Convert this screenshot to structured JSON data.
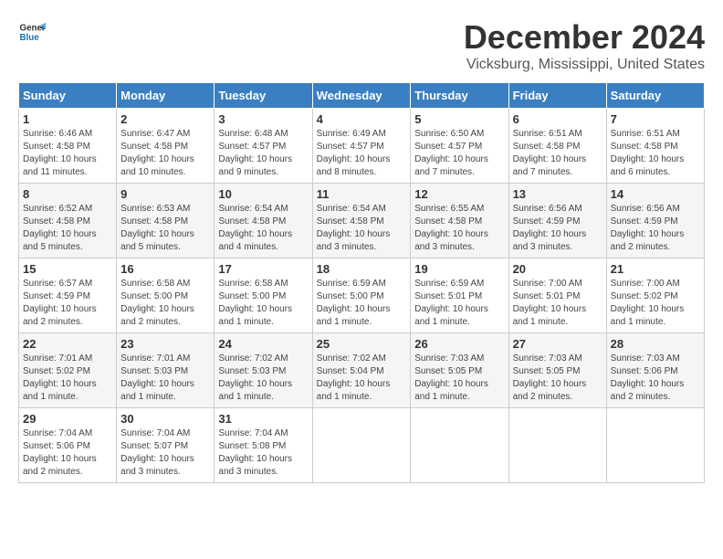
{
  "logo": {
    "general": "General",
    "blue": "Blue"
  },
  "title": "December 2024",
  "subtitle": "Vicksburg, Mississippi, United States",
  "days_of_week": [
    "Sunday",
    "Monday",
    "Tuesday",
    "Wednesday",
    "Thursday",
    "Friday",
    "Saturday"
  ],
  "weeks": [
    [
      {
        "day": "1",
        "sunrise": "Sunrise: 6:46 AM",
        "sunset": "Sunset: 4:58 PM",
        "daylight": "Daylight: 10 hours and 11 minutes."
      },
      {
        "day": "2",
        "sunrise": "Sunrise: 6:47 AM",
        "sunset": "Sunset: 4:58 PM",
        "daylight": "Daylight: 10 hours and 10 minutes."
      },
      {
        "day": "3",
        "sunrise": "Sunrise: 6:48 AM",
        "sunset": "Sunset: 4:57 PM",
        "daylight": "Daylight: 10 hours and 9 minutes."
      },
      {
        "day": "4",
        "sunrise": "Sunrise: 6:49 AM",
        "sunset": "Sunset: 4:57 PM",
        "daylight": "Daylight: 10 hours and 8 minutes."
      },
      {
        "day": "5",
        "sunrise": "Sunrise: 6:50 AM",
        "sunset": "Sunset: 4:57 PM",
        "daylight": "Daylight: 10 hours and 7 minutes."
      },
      {
        "day": "6",
        "sunrise": "Sunrise: 6:51 AM",
        "sunset": "Sunset: 4:58 PM",
        "daylight": "Daylight: 10 hours and 7 minutes."
      },
      {
        "day": "7",
        "sunrise": "Sunrise: 6:51 AM",
        "sunset": "Sunset: 4:58 PM",
        "daylight": "Daylight: 10 hours and 6 minutes."
      }
    ],
    [
      {
        "day": "8",
        "sunrise": "Sunrise: 6:52 AM",
        "sunset": "Sunset: 4:58 PM",
        "daylight": "Daylight: 10 hours and 5 minutes."
      },
      {
        "day": "9",
        "sunrise": "Sunrise: 6:53 AM",
        "sunset": "Sunset: 4:58 PM",
        "daylight": "Daylight: 10 hours and 5 minutes."
      },
      {
        "day": "10",
        "sunrise": "Sunrise: 6:54 AM",
        "sunset": "Sunset: 4:58 PM",
        "daylight": "Daylight: 10 hours and 4 minutes."
      },
      {
        "day": "11",
        "sunrise": "Sunrise: 6:54 AM",
        "sunset": "Sunset: 4:58 PM",
        "daylight": "Daylight: 10 hours and 3 minutes."
      },
      {
        "day": "12",
        "sunrise": "Sunrise: 6:55 AM",
        "sunset": "Sunset: 4:58 PM",
        "daylight": "Daylight: 10 hours and 3 minutes."
      },
      {
        "day": "13",
        "sunrise": "Sunrise: 6:56 AM",
        "sunset": "Sunset: 4:59 PM",
        "daylight": "Daylight: 10 hours and 3 minutes."
      },
      {
        "day": "14",
        "sunrise": "Sunrise: 6:56 AM",
        "sunset": "Sunset: 4:59 PM",
        "daylight": "Daylight: 10 hours and 2 minutes."
      }
    ],
    [
      {
        "day": "15",
        "sunrise": "Sunrise: 6:57 AM",
        "sunset": "Sunset: 4:59 PM",
        "daylight": "Daylight: 10 hours and 2 minutes."
      },
      {
        "day": "16",
        "sunrise": "Sunrise: 6:58 AM",
        "sunset": "Sunset: 5:00 PM",
        "daylight": "Daylight: 10 hours and 2 minutes."
      },
      {
        "day": "17",
        "sunrise": "Sunrise: 6:58 AM",
        "sunset": "Sunset: 5:00 PM",
        "daylight": "Daylight: 10 hours and 1 minute."
      },
      {
        "day": "18",
        "sunrise": "Sunrise: 6:59 AM",
        "sunset": "Sunset: 5:00 PM",
        "daylight": "Daylight: 10 hours and 1 minute."
      },
      {
        "day": "19",
        "sunrise": "Sunrise: 6:59 AM",
        "sunset": "Sunset: 5:01 PM",
        "daylight": "Daylight: 10 hours and 1 minute."
      },
      {
        "day": "20",
        "sunrise": "Sunrise: 7:00 AM",
        "sunset": "Sunset: 5:01 PM",
        "daylight": "Daylight: 10 hours and 1 minute."
      },
      {
        "day": "21",
        "sunrise": "Sunrise: 7:00 AM",
        "sunset": "Sunset: 5:02 PM",
        "daylight": "Daylight: 10 hours and 1 minute."
      }
    ],
    [
      {
        "day": "22",
        "sunrise": "Sunrise: 7:01 AM",
        "sunset": "Sunset: 5:02 PM",
        "daylight": "Daylight: 10 hours and 1 minute."
      },
      {
        "day": "23",
        "sunrise": "Sunrise: 7:01 AM",
        "sunset": "Sunset: 5:03 PM",
        "daylight": "Daylight: 10 hours and 1 minute."
      },
      {
        "day": "24",
        "sunrise": "Sunrise: 7:02 AM",
        "sunset": "Sunset: 5:03 PM",
        "daylight": "Daylight: 10 hours and 1 minute."
      },
      {
        "day": "25",
        "sunrise": "Sunrise: 7:02 AM",
        "sunset": "Sunset: 5:04 PM",
        "daylight": "Daylight: 10 hours and 1 minute."
      },
      {
        "day": "26",
        "sunrise": "Sunrise: 7:03 AM",
        "sunset": "Sunset: 5:05 PM",
        "daylight": "Daylight: 10 hours and 1 minute."
      },
      {
        "day": "27",
        "sunrise": "Sunrise: 7:03 AM",
        "sunset": "Sunset: 5:05 PM",
        "daylight": "Daylight: 10 hours and 2 minutes."
      },
      {
        "day": "28",
        "sunrise": "Sunrise: 7:03 AM",
        "sunset": "Sunset: 5:06 PM",
        "daylight": "Daylight: 10 hours and 2 minutes."
      }
    ],
    [
      {
        "day": "29",
        "sunrise": "Sunrise: 7:04 AM",
        "sunset": "Sunset: 5:06 PM",
        "daylight": "Daylight: 10 hours and 2 minutes."
      },
      {
        "day": "30",
        "sunrise": "Sunrise: 7:04 AM",
        "sunset": "Sunset: 5:07 PM",
        "daylight": "Daylight: 10 hours and 3 minutes."
      },
      {
        "day": "31",
        "sunrise": "Sunrise: 7:04 AM",
        "sunset": "Sunset: 5:08 PM",
        "daylight": "Daylight: 10 hours and 3 minutes."
      },
      null,
      null,
      null,
      null
    ]
  ]
}
